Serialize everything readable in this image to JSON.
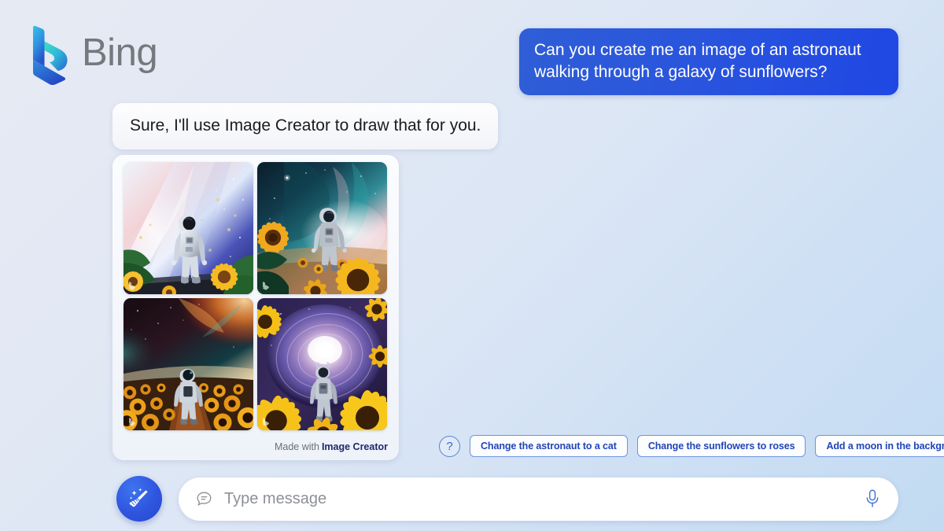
{
  "brand": {
    "name": "Bing",
    "logo_icon": "bing-b-logo",
    "wordmark_color": "#76787d"
  },
  "conversation": {
    "user_message": "Can you create me an image of an astronaut walking through a galaxy of sunflowers?",
    "assistant_message": "Sure, I'll use Image Creator to draw that for you.",
    "user_bubble_color": "#2a55dd",
    "assistant_bubble_color": "#f7f8fb"
  },
  "image_card": {
    "footer_prefix": "Made with",
    "footer_brand": "Image Creator",
    "images": [
      {
        "alt": "Astronaut in white suit walking toward a bright cosmic aurora with sunflowers and green leaves in the foreground"
      },
      {
        "alt": "Astronaut walking through a teal and pink nebula with large golden sunflowers in the foreground"
      },
      {
        "alt": "Astronaut seen from behind walking a path through a sunflower field under a fiery orange nebula"
      },
      {
        "alt": "Astronaut seen from behind walking into a glowing spiral galaxy framed by yellow sunflowers"
      }
    ]
  },
  "suggestions": {
    "help_icon": "question-mark-icon",
    "chips": [
      "Change the astronaut to a cat",
      "Change the sunflowers to roses",
      "Add a moon in the background"
    ],
    "chip_text_color": "#2245b8"
  },
  "composer": {
    "magic_button_icon": "magic-broom-icon",
    "bubble_icon": "chat-bubble-icon",
    "input_value": "",
    "input_placeholder": "Type message",
    "mic_icon": "microphone-icon",
    "accent_color": "#2f55de"
  }
}
